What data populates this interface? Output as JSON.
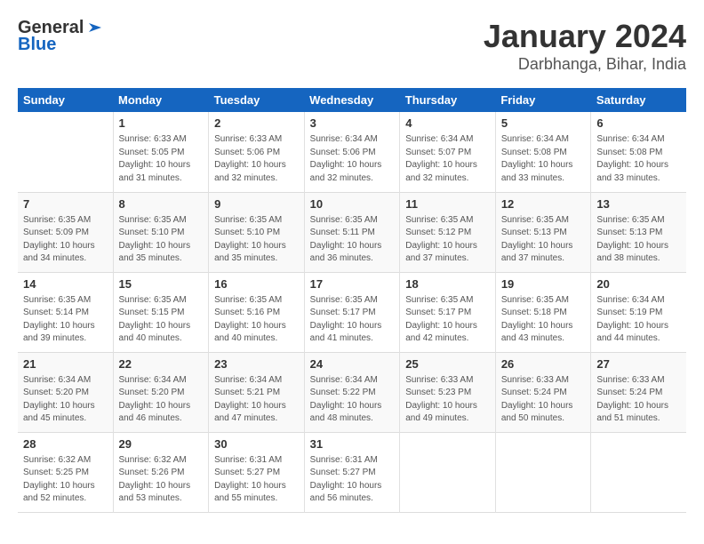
{
  "header": {
    "logo_general": "General",
    "logo_blue": "Blue",
    "title": "January 2024",
    "subtitle": "Darbhanga, Bihar, India"
  },
  "columns": [
    "Sunday",
    "Monday",
    "Tuesday",
    "Wednesday",
    "Thursday",
    "Friday",
    "Saturday"
  ],
  "weeks": [
    [
      {
        "day": "",
        "content": ""
      },
      {
        "day": "1",
        "content": "Sunrise: 6:33 AM\nSunset: 5:05 PM\nDaylight: 10 hours\nand 31 minutes."
      },
      {
        "day": "2",
        "content": "Sunrise: 6:33 AM\nSunset: 5:06 PM\nDaylight: 10 hours\nand 32 minutes."
      },
      {
        "day": "3",
        "content": "Sunrise: 6:34 AM\nSunset: 5:06 PM\nDaylight: 10 hours\nand 32 minutes."
      },
      {
        "day": "4",
        "content": "Sunrise: 6:34 AM\nSunset: 5:07 PM\nDaylight: 10 hours\nand 32 minutes."
      },
      {
        "day": "5",
        "content": "Sunrise: 6:34 AM\nSunset: 5:08 PM\nDaylight: 10 hours\nand 33 minutes."
      },
      {
        "day": "6",
        "content": "Sunrise: 6:34 AM\nSunset: 5:08 PM\nDaylight: 10 hours\nand 33 minutes."
      }
    ],
    [
      {
        "day": "7",
        "content": "Sunrise: 6:35 AM\nSunset: 5:09 PM\nDaylight: 10 hours\nand 34 minutes."
      },
      {
        "day": "8",
        "content": "Sunrise: 6:35 AM\nSunset: 5:10 PM\nDaylight: 10 hours\nand 35 minutes."
      },
      {
        "day": "9",
        "content": "Sunrise: 6:35 AM\nSunset: 5:10 PM\nDaylight: 10 hours\nand 35 minutes."
      },
      {
        "day": "10",
        "content": "Sunrise: 6:35 AM\nSunset: 5:11 PM\nDaylight: 10 hours\nand 36 minutes."
      },
      {
        "day": "11",
        "content": "Sunrise: 6:35 AM\nSunset: 5:12 PM\nDaylight: 10 hours\nand 37 minutes."
      },
      {
        "day": "12",
        "content": "Sunrise: 6:35 AM\nSunset: 5:13 PM\nDaylight: 10 hours\nand 37 minutes."
      },
      {
        "day": "13",
        "content": "Sunrise: 6:35 AM\nSunset: 5:13 PM\nDaylight: 10 hours\nand 38 minutes."
      }
    ],
    [
      {
        "day": "14",
        "content": "Sunrise: 6:35 AM\nSunset: 5:14 PM\nDaylight: 10 hours\nand 39 minutes."
      },
      {
        "day": "15",
        "content": "Sunrise: 6:35 AM\nSunset: 5:15 PM\nDaylight: 10 hours\nand 40 minutes."
      },
      {
        "day": "16",
        "content": "Sunrise: 6:35 AM\nSunset: 5:16 PM\nDaylight: 10 hours\nand 40 minutes."
      },
      {
        "day": "17",
        "content": "Sunrise: 6:35 AM\nSunset: 5:17 PM\nDaylight: 10 hours\nand 41 minutes."
      },
      {
        "day": "18",
        "content": "Sunrise: 6:35 AM\nSunset: 5:17 PM\nDaylight: 10 hours\nand 42 minutes."
      },
      {
        "day": "19",
        "content": "Sunrise: 6:35 AM\nSunset: 5:18 PM\nDaylight: 10 hours\nand 43 minutes."
      },
      {
        "day": "20",
        "content": "Sunrise: 6:34 AM\nSunset: 5:19 PM\nDaylight: 10 hours\nand 44 minutes."
      }
    ],
    [
      {
        "day": "21",
        "content": "Sunrise: 6:34 AM\nSunset: 5:20 PM\nDaylight: 10 hours\nand 45 minutes."
      },
      {
        "day": "22",
        "content": "Sunrise: 6:34 AM\nSunset: 5:20 PM\nDaylight: 10 hours\nand 46 minutes."
      },
      {
        "day": "23",
        "content": "Sunrise: 6:34 AM\nSunset: 5:21 PM\nDaylight: 10 hours\nand 47 minutes."
      },
      {
        "day": "24",
        "content": "Sunrise: 6:34 AM\nSunset: 5:22 PM\nDaylight: 10 hours\nand 48 minutes."
      },
      {
        "day": "25",
        "content": "Sunrise: 6:33 AM\nSunset: 5:23 PM\nDaylight: 10 hours\nand 49 minutes."
      },
      {
        "day": "26",
        "content": "Sunrise: 6:33 AM\nSunset: 5:24 PM\nDaylight: 10 hours\nand 50 minutes."
      },
      {
        "day": "27",
        "content": "Sunrise: 6:33 AM\nSunset: 5:24 PM\nDaylight: 10 hours\nand 51 minutes."
      }
    ],
    [
      {
        "day": "28",
        "content": "Sunrise: 6:32 AM\nSunset: 5:25 PM\nDaylight: 10 hours\nand 52 minutes."
      },
      {
        "day": "29",
        "content": "Sunrise: 6:32 AM\nSunset: 5:26 PM\nDaylight: 10 hours\nand 53 minutes."
      },
      {
        "day": "30",
        "content": "Sunrise: 6:31 AM\nSunset: 5:27 PM\nDaylight: 10 hours\nand 55 minutes."
      },
      {
        "day": "31",
        "content": "Sunrise: 6:31 AM\nSunset: 5:27 PM\nDaylight: 10 hours\nand 56 minutes."
      },
      {
        "day": "",
        "content": ""
      },
      {
        "day": "",
        "content": ""
      },
      {
        "day": "",
        "content": ""
      }
    ]
  ]
}
